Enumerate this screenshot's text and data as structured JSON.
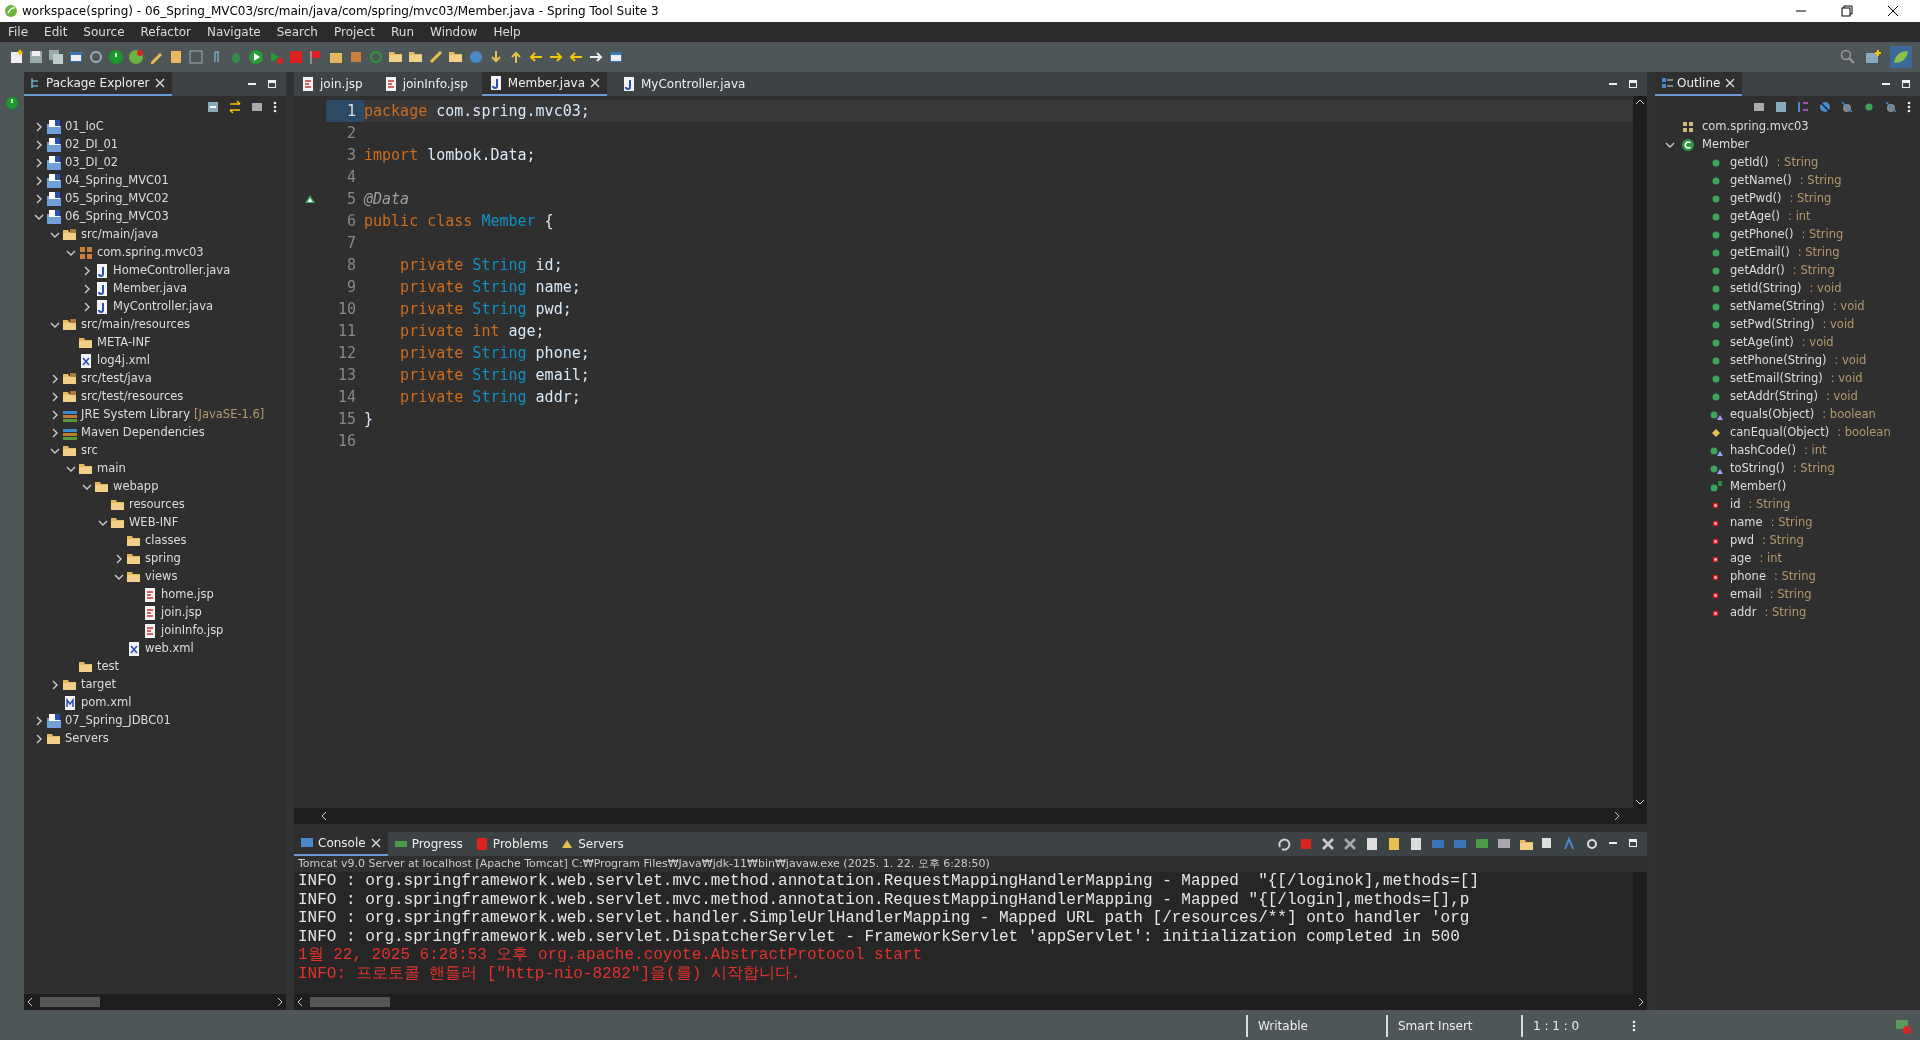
{
  "window": {
    "title": "workspace(spring) - 06_Spring_MVC03/src/main/java/com/spring/mvc03/Member.java - Spring Tool Suite 3"
  },
  "menu": [
    "File",
    "Edit",
    "Source",
    "Refactor",
    "Navigate",
    "Search",
    "Project",
    "Run",
    "Window",
    "Help"
  ],
  "package_explorer": {
    "title": "Package Explorer",
    "tree": [
      {
        "label": "01_IoC",
        "kind": "project",
        "expanded": false
      },
      {
        "label": "02_DI_01",
        "kind": "project",
        "expanded": false
      },
      {
        "label": "03_DI_02",
        "kind": "project",
        "expanded": false
      },
      {
        "label": "04_Spring_MVC01",
        "kind": "project",
        "expanded": false
      },
      {
        "label": "05_Spring_MVC02",
        "kind": "project",
        "expanded": false
      },
      {
        "label": "06_Spring_MVC03",
        "kind": "project",
        "expanded": true,
        "children": [
          {
            "label": "src/main/java",
            "kind": "source-folder",
            "expanded": true,
            "children": [
              {
                "label": "com.spring.mvc03",
                "kind": "package",
                "expanded": true,
                "children": [
                  {
                    "label": "HomeController.java",
                    "kind": "java-file",
                    "expanded": false
                  },
                  {
                    "label": "Member.java",
                    "kind": "java-file",
                    "expanded": false
                  },
                  {
                    "label": "MyController.java",
                    "kind": "java-file",
                    "expanded": false
                  }
                ]
              }
            ]
          },
          {
            "label": "src/main/resources",
            "kind": "source-folder",
            "expanded": true,
            "children": [
              {
                "label": "META-INF",
                "kind": "folder"
              },
              {
                "label": "log4j.xml",
                "kind": "xml-file"
              }
            ]
          },
          {
            "label": "src/test/java",
            "kind": "source-folder",
            "expanded": false
          },
          {
            "label": "src/test/resources",
            "kind": "source-folder",
            "expanded": false
          },
          {
            "label": "JRE System Library",
            "decoration": "[JavaSE-1.6]",
            "kind": "library",
            "expanded": false
          },
          {
            "label": "Maven Dependencies",
            "kind": "library",
            "expanded": false
          },
          {
            "label": "src",
            "kind": "folder",
            "expanded": true,
            "children": [
              {
                "label": "main",
                "kind": "folder",
                "expanded": true,
                "children": [
                  {
                    "label": "webapp",
                    "kind": "folder",
                    "expanded": true,
                    "children": [
                      {
                        "label": "resources",
                        "kind": "folder"
                      },
                      {
                        "label": "WEB-INF",
                        "kind": "folder",
                        "expanded": true,
                        "children": [
                          {
                            "label": "classes",
                            "kind": "folder"
                          },
                          {
                            "label": "spring",
                            "kind": "folder",
                            "expanded": false
                          },
                          {
                            "label": "views",
                            "kind": "folder",
                            "expanded": true,
                            "children": [
                              {
                                "label": "home.jsp",
                                "kind": "jsp-file"
                              },
                              {
                                "label": "join.jsp",
                                "kind": "jsp-file"
                              },
                              {
                                "label": "joinInfo.jsp",
                                "kind": "jsp-file"
                              }
                            ]
                          },
                          {
                            "label": "web.xml",
                            "kind": "xml-file"
                          }
                        ]
                      }
                    ]
                  }
                ]
              },
              {
                "label": "test",
                "kind": "folder"
              }
            ]
          },
          {
            "label": "target",
            "kind": "folder",
            "expanded": false
          },
          {
            "label": "pom.xml",
            "kind": "pom-file"
          }
        ]
      },
      {
        "label": "07_Spring_JDBC01",
        "kind": "project",
        "expanded": false
      },
      {
        "label": "Servers",
        "kind": "folder",
        "expanded": false
      }
    ]
  },
  "editor": {
    "tabs": [
      {
        "label": "join.jsp",
        "kind": "jsp-file",
        "selected": false
      },
      {
        "label": "joinInfo.jsp",
        "kind": "jsp-file",
        "selected": false
      },
      {
        "label": "Member.java",
        "kind": "java-file",
        "selected": true
      },
      {
        "label": "MyController.java",
        "kind": "java-file",
        "selected": false
      }
    ],
    "lines": [
      {
        "number": "1",
        "current": true,
        "marker": false,
        "tokens": [
          {
            "text": "package",
            "kind": "keyword"
          },
          {
            "text": " com.spring.mvc03;",
            "kind": "plain"
          }
        ]
      },
      {
        "number": "2",
        "current": false,
        "marker": false
      },
      {
        "number": "3",
        "current": false,
        "marker": false,
        "tokens": [
          {
            "text": "import",
            "kind": "keyword"
          },
          {
            "text": " lombok.Data;",
            "kind": "plain"
          }
        ]
      },
      {
        "number": "4",
        "current": false,
        "marker": false
      },
      {
        "number": "5",
        "current": false,
        "marker": true,
        "tokens": [
          {
            "text": "@Data",
            "kind": "annotation"
          }
        ]
      },
      {
        "number": "6",
        "current": false,
        "marker": false,
        "tokens": [
          {
            "text": "public class",
            "kind": "keyword"
          },
          {
            "text": " Member",
            "kind": "type"
          },
          {
            "text": " {",
            "kind": "plain"
          }
        ]
      },
      {
        "number": "7",
        "current": false,
        "marker": false
      },
      {
        "number": "8",
        "current": false,
        "marker": false,
        "tokens": [
          {
            "text": "    private",
            "kind": "keyword"
          },
          {
            "text": " String",
            "kind": "type"
          },
          {
            "text": " id;",
            "kind": "plain"
          }
        ]
      },
      {
        "number": "9",
        "current": false,
        "marker": false,
        "tokens": [
          {
            "text": "    private",
            "kind": "keyword"
          },
          {
            "text": " String",
            "kind": "type"
          },
          {
            "text": " name;",
            "kind": "plain"
          }
        ]
      },
      {
        "number": "10",
        "current": false,
        "marker": false,
        "tokens": [
          {
            "text": "    private",
            "kind": "keyword"
          },
          {
            "text": " String",
            "kind": "type"
          },
          {
            "text": " pwd;",
            "kind": "plain"
          }
        ]
      },
      {
        "number": "11",
        "current": false,
        "marker": false,
        "tokens": [
          {
            "text": "    private int",
            "kind": "keyword"
          },
          {
            "text": " age;",
            "kind": "plain"
          }
        ]
      },
      {
        "number": "12",
        "current": false,
        "marker": false,
        "tokens": [
          {
            "text": "    private",
            "kind": "keyword"
          },
          {
            "text": " String",
            "kind": "type"
          },
          {
            "text": " phone;",
            "kind": "plain"
          }
        ]
      },
      {
        "number": "13",
        "current": false,
        "marker": false,
        "tokens": [
          {
            "text": "    private",
            "kind": "keyword"
          },
          {
            "text": " String",
            "kind": "type"
          },
          {
            "text": " email;",
            "kind": "plain"
          }
        ]
      },
      {
        "number": "14",
        "current": false,
        "marker": false,
        "tokens": [
          {
            "text": "    private",
            "kind": "keyword"
          },
          {
            "text": " String",
            "kind": "type"
          },
          {
            "text": " addr;",
            "kind": "plain"
          }
        ]
      },
      {
        "number": "15",
        "current": false,
        "marker": false,
        "tokens": [
          {
            "text": "}",
            "kind": "plain"
          }
        ]
      },
      {
        "number": "16",
        "current": false,
        "marker": false
      }
    ]
  },
  "outline": {
    "title": "Outline",
    "items": [
      {
        "label": "com.spring.mvc03",
        "kind": "package"
      },
      {
        "label": "Member",
        "kind": "class",
        "expanded": true,
        "children": [
          {
            "label": "getId()",
            "type": ": String",
            "kind": "method"
          },
          {
            "label": "getName()",
            "type": ": String",
            "kind": "method"
          },
          {
            "label": "getPwd()",
            "type": ": String",
            "kind": "method"
          },
          {
            "label": "getAge()",
            "type": ": int",
            "kind": "method"
          },
          {
            "label": "getPhone()",
            "type": ": String",
            "kind": "method"
          },
          {
            "label": "getEmail()",
            "type": ": String",
            "kind": "method"
          },
          {
            "label": "getAddr()",
            "type": ": String",
            "kind": "method"
          },
          {
            "label": "setId(String)",
            "type": ": void",
            "kind": "method"
          },
          {
            "label": "setName(String)",
            "type": ": void",
            "kind": "method"
          },
          {
            "label": "setPwd(String)",
            "type": ": void",
            "kind": "method"
          },
          {
            "label": "setAge(int)",
            "type": ": void",
            "kind": "method"
          },
          {
            "label": "setPhone(String)",
            "type": ": void",
            "kind": "method"
          },
          {
            "label": "setEmail(String)",
            "type": ": void",
            "kind": "method"
          },
          {
            "label": "setAddr(String)",
            "type": ": void",
            "kind": "method"
          },
          {
            "label": "equals(Object)",
            "type": ": boolean",
            "kind": "override"
          },
          {
            "label": "canEqual(Object)",
            "type": ": boolean",
            "kind": "protected"
          },
          {
            "label": "hashCode()",
            "type": ": int",
            "kind": "override"
          },
          {
            "label": "toString()",
            "type": ": String",
            "kind": "override"
          },
          {
            "label": "Member()",
            "kind": "constructor"
          },
          {
            "label": "id",
            "type": ": String",
            "kind": "field"
          },
          {
            "label": "name",
            "type": ": String",
            "kind": "field"
          },
          {
            "label": "pwd",
            "type": ": String",
            "kind": "field"
          },
          {
            "label": "age",
            "type": ": int",
            "kind": "field"
          },
          {
            "label": "phone",
            "type": ": String",
            "kind": "field"
          },
          {
            "label": "email",
            "type": ": String",
            "kind": "field"
          },
          {
            "label": "addr",
            "type": ": String",
            "kind": "field"
          }
        ]
      }
    ]
  },
  "console": {
    "tabs": [
      {
        "label": "Console",
        "selected": true
      },
      {
        "label": "Progress",
        "selected": false
      },
      {
        "label": "Problems",
        "selected": false
      },
      {
        "label": "Servers",
        "selected": false
      }
    ],
    "header": "Tomcat v9.0 Server at localhost [Apache Tomcat] C:₩Program Files₩Java₩jdk-11₩bin₩javaw.exe  (2025. 1. 22. 오후 6:28:50)",
    "lines": [
      {
        "text": "INFO : org.springframework.web.servlet.mvc.method.annotation.RequestMappingHandlerMapping - Mapped  \"{[/loginok],methods=[]",
        "kind": "out"
      },
      {
        "text": "INFO : org.springframework.web.servlet.mvc.method.annotation.RequestMappingHandlerMapping - Mapped \"{[/login],methods=[],p",
        "kind": "out"
      },
      {
        "text": "INFO : org.springframework.web.servlet.handler.SimpleUrlHandlerMapping - Mapped URL path [/resources/**] onto handler 'org",
        "kind": "out"
      },
      {
        "text": "INFO : org.springframework.web.servlet.DispatcherServlet - FrameworkServlet 'appServlet': initialization completed in 500",
        "kind": "out"
      },
      {
        "text": "1월 22, 2025 6:28:53 오후 org.apache.coyote.AbstractProtocol start",
        "kind": "err"
      },
      {
        "text": "INFO: 프로토콜 핸들러 [\"http-nio-8282\"]을(를) 시작합니다.",
        "kind": "err"
      }
    ]
  },
  "status_bar": [
    "Writable",
    "Smart Insert",
    "1 : 1 : 0"
  ]
}
